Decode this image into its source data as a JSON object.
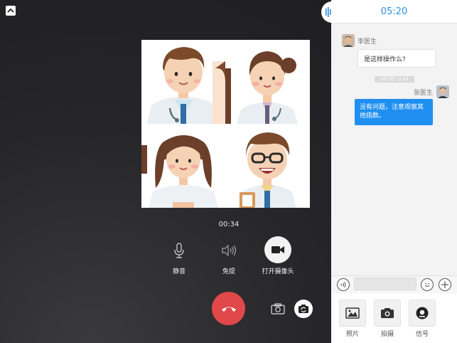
{
  "call": {
    "timer": "00:34",
    "controls": {
      "mute_label": "静音",
      "speaker_label": "免提",
      "camera_label": "打开摄像头"
    }
  },
  "chat": {
    "header_time": "05:20",
    "messages": [
      {
        "sender": "李医生",
        "text": "是这样操作么?",
        "direction": "incoming"
      },
      {
        "sender": "张医生",
        "text": "没有问题，注意观察其他指数。",
        "direction": "outgoing"
      }
    ],
    "timestamp": "9月1日 12:24",
    "input_value": "",
    "tools": [
      {
        "label": "照片",
        "icon": "image-icon"
      },
      {
        "label": "拍摄",
        "icon": "camera-icon"
      },
      {
        "label": "信号",
        "icon": "signal-icon"
      }
    ]
  },
  "colors": {
    "accent_blue": "#1e8ff0",
    "hangup_red": "#e0484a",
    "header_time_blue": "#2b8de3"
  }
}
